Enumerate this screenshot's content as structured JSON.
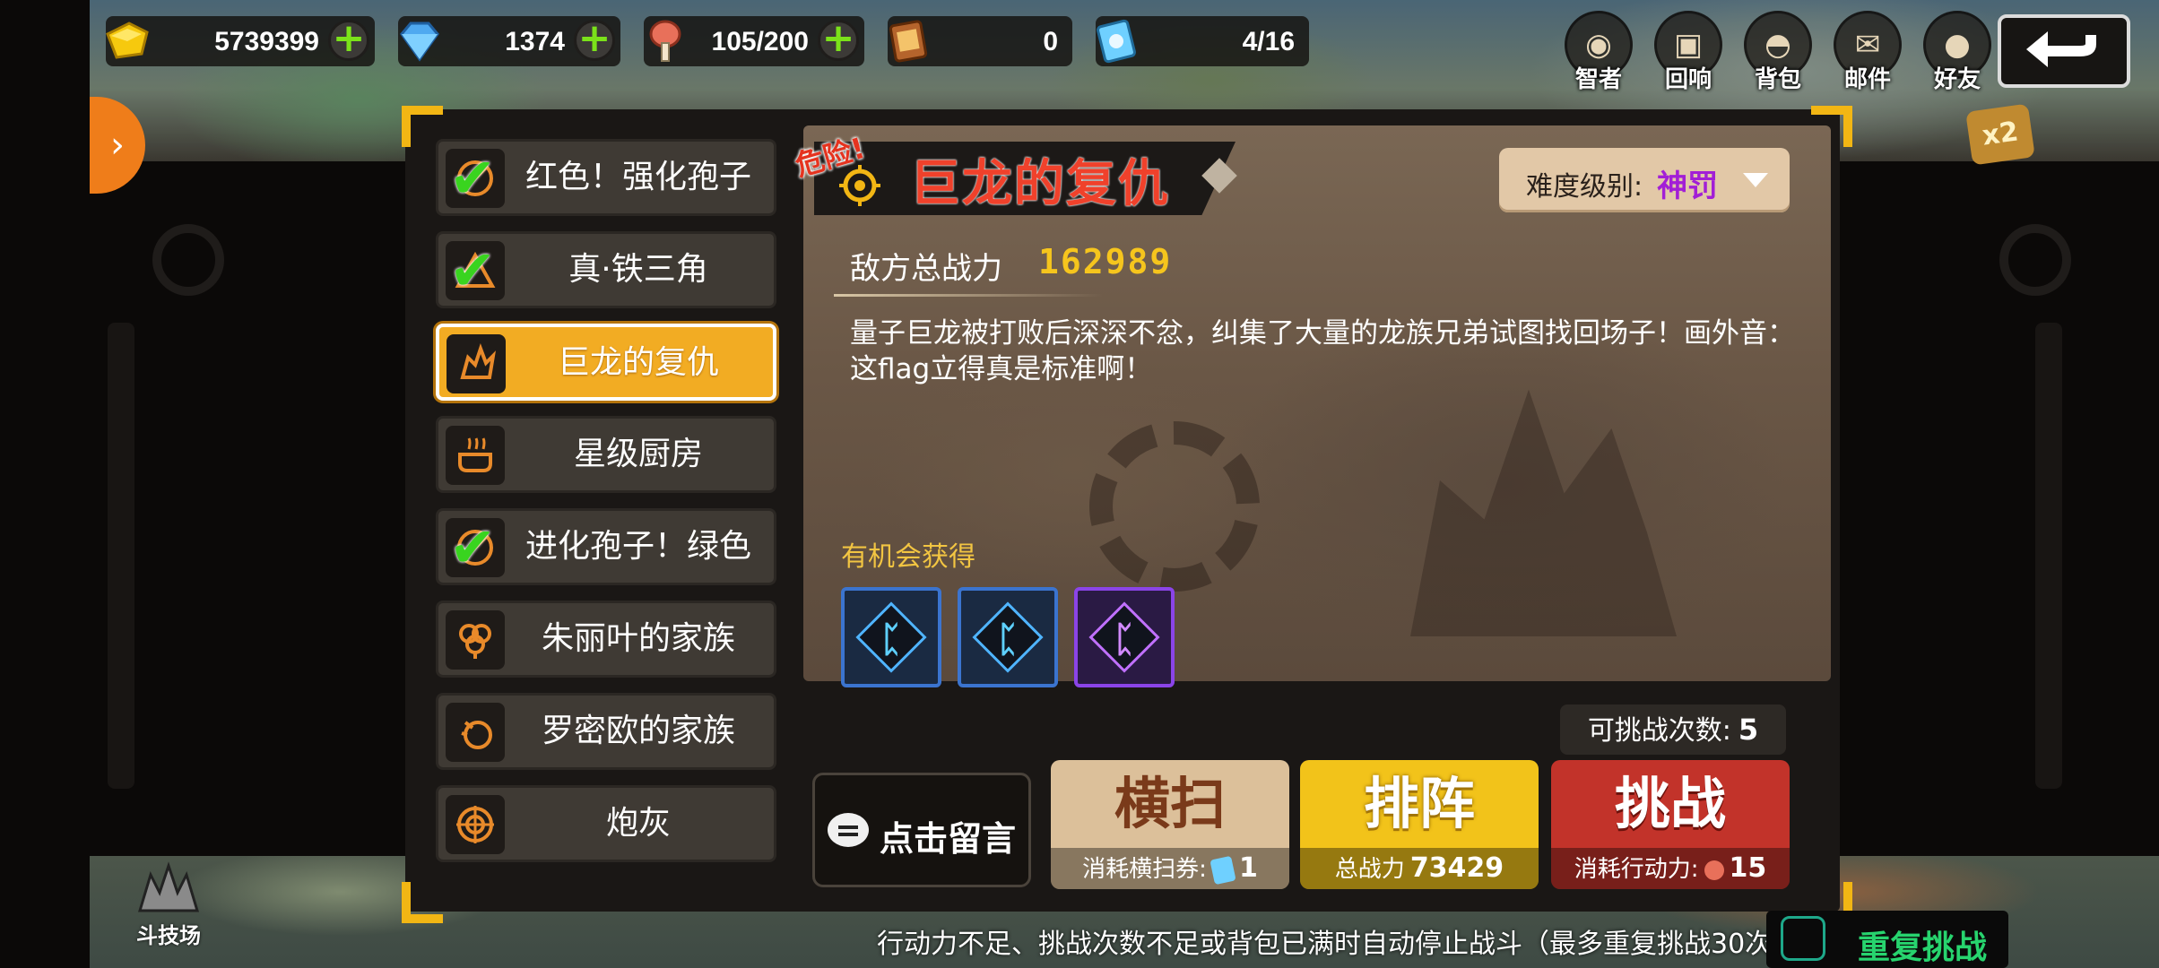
{
  "resources": [
    {
      "name": "gold",
      "value": "5739399",
      "icon": "gold-icon",
      "plus": true
    },
    {
      "name": "diamond",
      "value": "1374",
      "icon": "diamond-icon",
      "plus": true
    },
    {
      "name": "stamina",
      "value": "105/200",
      "icon": "meat-icon",
      "plus": true
    },
    {
      "name": "card",
      "value": "0",
      "icon": "card-icon",
      "plus": false
    },
    {
      "name": "ticket",
      "value": "4/16",
      "icon": "ticket-icon",
      "plus": false
    }
  ],
  "top_nav": [
    {
      "label": "智者",
      "icon": "sage-icon"
    },
    {
      "label": "回响",
      "icon": "echo-icon"
    },
    {
      "label": "背包",
      "icon": "backpack-icon"
    },
    {
      "label": "邮件",
      "icon": "mail-icon"
    },
    {
      "label": "好友",
      "icon": "friends-icon"
    }
  ],
  "badge_multiplier": "x2",
  "stages": [
    {
      "name": "红色！强化孢子",
      "cleared": true,
      "active": false
    },
    {
      "name": "真·铁三角",
      "cleared": true,
      "active": false
    },
    {
      "name": "巨龙的复仇",
      "cleared": false,
      "active": true
    },
    {
      "name": "星级厨房",
      "cleared": false,
      "active": false
    },
    {
      "name": "进化孢子！绿色",
      "cleared": true,
      "active": false
    },
    {
      "name": "朱丽叶的家族",
      "cleared": false,
      "active": false
    },
    {
      "name": "罗密欧的家族",
      "cleared": false,
      "active": false
    },
    {
      "name": "炮灰",
      "cleared": false,
      "active": false
    }
  ],
  "detail": {
    "danger_tag": "危险!",
    "title": "巨龙的复仇",
    "difficulty_label": "难度级别:",
    "difficulty_value": "神罚",
    "enemy_power_label": "敌方总战力",
    "enemy_power_value": "162989",
    "description": "量子巨龙被打败后深深不忿，纠集了大量的龙族兄弟试图找回场子！画外音：这flag立得真是标准啊！",
    "drops_label": "有机会获得",
    "drops": [
      {
        "rarity": "blue",
        "icon": "rune-icon"
      },
      {
        "rarity": "blue",
        "icon": "rune-icon"
      },
      {
        "rarity": "purple",
        "icon": "rune-icon"
      }
    ]
  },
  "attempts": {
    "label": "可挑战次数:",
    "value": "5"
  },
  "comment_button": "点击留言",
  "actions": {
    "sweep": {
      "label": "横扫",
      "sub_label": "消耗横扫券:",
      "sub_value": "1"
    },
    "lineup": {
      "label": "排阵",
      "sub_label": "总战力",
      "sub_value": "73429"
    },
    "challenge": {
      "label": "挑战",
      "sub_label": "消耗行动力:",
      "sub_value": "15"
    }
  },
  "footer_note": "行动力不足、挑战次数不足或背包已满时自动停止战斗（最多重复挑战30次）",
  "repeat_label": "重复挑战",
  "arena_label": "斗技场",
  "colors": {
    "accent": "#f2ac23",
    "danger": "#f0412b",
    "power": "#f6c51d",
    "difficulty": "#a21fd6",
    "confirm": "#27d46e"
  }
}
